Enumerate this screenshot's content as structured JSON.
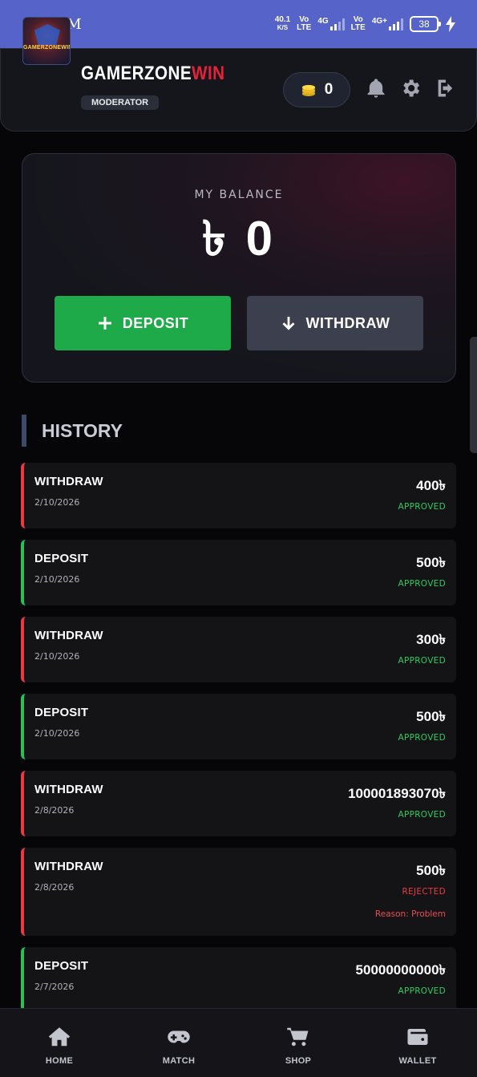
{
  "status_bar": {
    "time": "7:44 PM",
    "speed_value": "40.1",
    "speed_unit": "K/S",
    "sim1_top": "Vo",
    "sim1_bottom": "LTE",
    "net1": "4G",
    "sim2_top": "Vo",
    "sim2_bottom": "LTE",
    "net2": "4G+",
    "battery": "38"
  },
  "header": {
    "logo_text": "GAMERZONEWIN",
    "brand_part1": "GAMERZONE",
    "brand_part2": "WIN",
    "role": "MODERATOR",
    "coin_count": "0",
    "brand_accent_color": "#e6213a"
  },
  "balance": {
    "label": "MY BALANCE",
    "amount": "৳ 0",
    "deposit_label": "DEPOSIT",
    "withdraw_label": "WITHDRAW"
  },
  "history": {
    "title": "HISTORY",
    "items": [
      {
        "type": "WITHDRAW",
        "date": "2/10/2026",
        "amount": "400৳",
        "status": "APPROVED"
      },
      {
        "type": "DEPOSIT",
        "date": "2/10/2026",
        "amount": "500৳",
        "status": "APPROVED"
      },
      {
        "type": "WITHDRAW",
        "date": "2/10/2026",
        "amount": "300৳",
        "status": "APPROVED"
      },
      {
        "type": "DEPOSIT",
        "date": "2/10/2026",
        "amount": "500৳",
        "status": "APPROVED"
      },
      {
        "type": "WITHDRAW",
        "date": "2/8/2026",
        "amount": "100001893070৳",
        "status": "APPROVED"
      },
      {
        "type": "WITHDRAW",
        "date": "2/8/2026",
        "amount": "500৳",
        "status": "REJECTED",
        "reason": "Reason: Problem"
      },
      {
        "type": "DEPOSIT",
        "date": "2/7/2026",
        "amount": "50000000000৳",
        "status": "APPROVED"
      }
    ]
  },
  "bottom_nav": {
    "items": [
      {
        "label": "HOME",
        "icon": "home-icon"
      },
      {
        "label": "MATCH",
        "icon": "gamepad-icon"
      },
      {
        "label": "SHOP",
        "icon": "cart-icon"
      },
      {
        "label": "WALLET",
        "icon": "wallet-icon"
      }
    ]
  },
  "colors": {
    "status_bar": "#5663c9",
    "deposit_green": "#1faa4a",
    "withdraw_red": "#ec3a44",
    "approved_green": "#2fcb62"
  }
}
